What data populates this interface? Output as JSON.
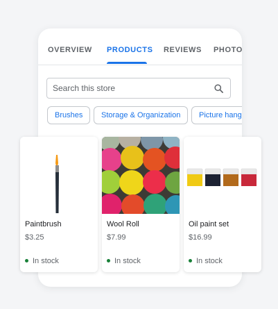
{
  "tabs": [
    {
      "label": "OVERVIEW",
      "active": false
    },
    {
      "label": "PRODUCTS",
      "active": true
    },
    {
      "label": "REVIEWS",
      "active": false
    },
    {
      "label": "PHOTO",
      "active": false
    }
  ],
  "search": {
    "placeholder": "Search this store"
  },
  "chips": [
    "Brushes",
    "Storage & Organization",
    "Picture hange"
  ],
  "products": [
    {
      "name": "Paintbrush",
      "price": "$3.25",
      "stock": "In stock"
    },
    {
      "name": "Wool Roll",
      "price": "$7.99",
      "stock": "In stock"
    },
    {
      "name": "Oil paint set",
      "price": "$16.99",
      "stock": "In stock"
    }
  ],
  "colors": {
    "accent": "#1a73e8",
    "in_stock": "#188038"
  }
}
